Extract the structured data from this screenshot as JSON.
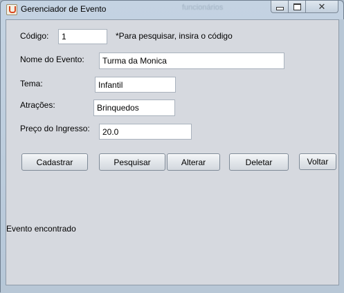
{
  "window": {
    "title": "Gerenciador de Evento",
    "background_title": "funcionários"
  },
  "form": {
    "codigo": {
      "label": "Código:",
      "value": "1",
      "hint": "*Para pesquisar, insira o código"
    },
    "nome": {
      "label": "Nome do Evento:",
      "value": "Turma da Monica"
    },
    "tema": {
      "label": "Tema:",
      "value": "Infantil"
    },
    "atracoes": {
      "label": "Atrações:",
      "value": "Brinquedos"
    },
    "preco": {
      "label": "Preço do Ingresso:",
      "value": "20.0"
    }
  },
  "buttons": {
    "cadastrar": "Cadastrar",
    "pesquisar": "Pesquisar",
    "alterar": "Alterar",
    "deletar": "Deletar",
    "voltar": "Voltar"
  },
  "status": "Evento encontrado",
  "icons": [
    "java-app-icon",
    "minimize-icon",
    "maximize-icon",
    "close-icon"
  ]
}
